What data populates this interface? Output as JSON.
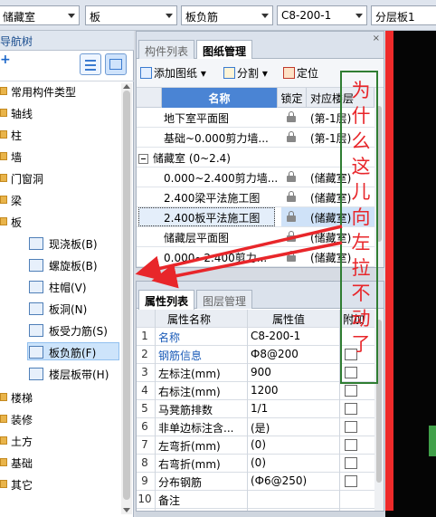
{
  "topbar": {
    "combos": [
      "储藏室",
      "板",
      "板负筋",
      "C8-200-1",
      "分层板1"
    ]
  },
  "nav": {
    "title": "导航树",
    "plus": "+",
    "tree": [
      {
        "label": "常用构件类型"
      },
      {
        "label": "轴线"
      },
      {
        "label": "柱"
      },
      {
        "label": "墙"
      },
      {
        "label": "门窗洞"
      },
      {
        "label": "梁"
      },
      {
        "label": "板"
      }
    ],
    "slab_children": [
      {
        "label": "现浇板(B)",
        "icon": "cast-slab-icon"
      },
      {
        "label": "螺旋板(B)",
        "icon": "spiral-slab-icon"
      },
      {
        "label": "柱帽(V)",
        "icon": "column-cap-icon"
      },
      {
        "label": "板洞(N)",
        "icon": "slab-hole-icon"
      },
      {
        "label": "板受力筋(S)",
        "icon": "slab-rebar-icon"
      },
      {
        "label": "板负筋(F)",
        "icon": "negative-rebar-icon"
      },
      {
        "label": "楼层板带(H)",
        "icon": "slab-strip-icon"
      }
    ],
    "tree_after": [
      {
        "label": "楼梯"
      },
      {
        "label": "装修"
      },
      {
        "label": "土方"
      },
      {
        "label": "基础"
      },
      {
        "label": "其它"
      }
    ]
  },
  "upper": {
    "tabs": [
      "构件列表",
      "图纸管理"
    ],
    "close": "×",
    "toolbar": {
      "add": "添加图纸",
      "split": "分割",
      "locate": "定位"
    },
    "columns": {
      "name": "名称",
      "lock": "锁定",
      "floor": "对应楼层"
    },
    "rows": [
      {
        "name": "地下室平面图",
        "floor": "(第-1层)",
        "group": false
      },
      {
        "name": "基础~0.000剪力墙...",
        "floor": "(第-1层)",
        "group": false
      },
      {
        "name": "储藏室 (0~2.4)",
        "floor": "",
        "group": true
      },
      {
        "name": "0.000~2.400剪力墙...",
        "floor": "(储藏室)",
        "group": false
      },
      {
        "name": "2.400梁平法施工图",
        "floor": "(储藏室)",
        "group": false
      },
      {
        "name": "2.400板平法施工图",
        "floor": "(储藏室)",
        "group": false,
        "selected": true
      },
      {
        "name": "储藏层平面图",
        "floor": "(储藏室)",
        "group": false
      },
      {
        "name": "0.000~2.400剪力...",
        "floor": "(储藏室)",
        "group": false
      }
    ]
  },
  "lower": {
    "tabs": [
      "属性列表",
      "图层管理"
    ],
    "columns": {
      "key": "属性名称",
      "value": "属性值",
      "extra": "附加"
    },
    "rows": [
      {
        "num": "1",
        "key": "名称",
        "value": "C8-200-1",
        "blue": true,
        "check": false
      },
      {
        "num": "2",
        "key": "钢筋信息",
        "value": "Ф8@200",
        "blue": true,
        "check": true
      },
      {
        "num": "3",
        "key": "左标注(mm)",
        "value": "900",
        "blue": false,
        "check": true
      },
      {
        "num": "4",
        "key": "右标注(mm)",
        "value": "1200",
        "blue": false,
        "check": true
      },
      {
        "num": "5",
        "key": "马凳筋排数",
        "value": "1/1",
        "blue": false,
        "check": true
      },
      {
        "num": "6",
        "key": "非单边标注含...",
        "value": "(是)",
        "blue": false,
        "check": true
      },
      {
        "num": "7",
        "key": "左弯折(mm)",
        "value": "(0)",
        "blue": false,
        "check": true
      },
      {
        "num": "8",
        "key": "右弯折(mm)",
        "value": "(0)",
        "blue": false,
        "check": true
      },
      {
        "num": "9",
        "key": "分布钢筋",
        "value": "(Ф6@250)",
        "blue": false,
        "check": true
      },
      {
        "num": "10",
        "key": "备注",
        "value": "",
        "blue": false,
        "check": false
      }
    ]
  },
  "annotation": {
    "text": "为什么这儿向左拉不动了",
    "text_color": "#e8262a",
    "box_color": "#2f7d32"
  }
}
